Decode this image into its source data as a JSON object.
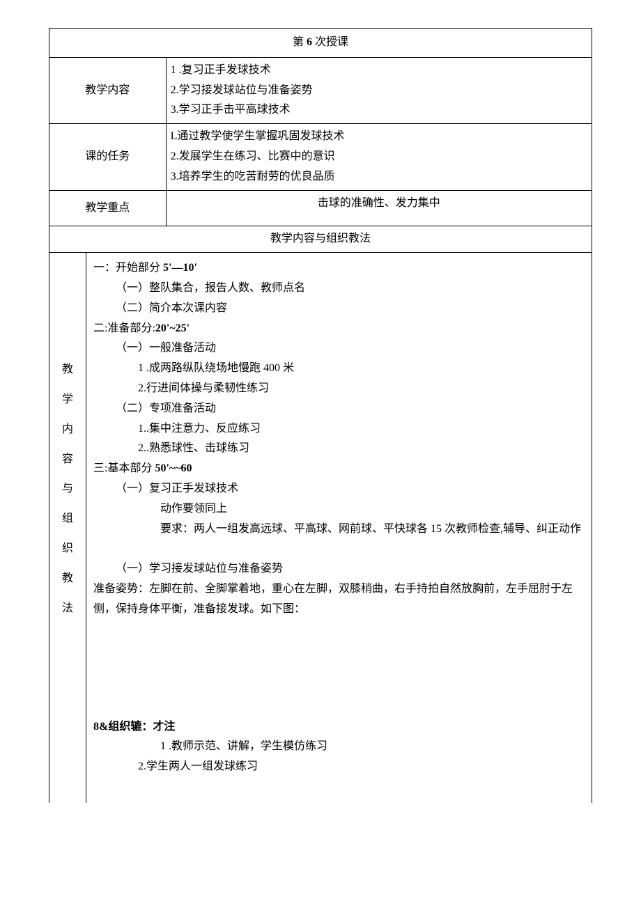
{
  "title_prefix": "第",
  "title_num": "6",
  "title_suffix": "次授课",
  "row1_label": "教学内容",
  "row1_lines": {
    "prefix1": "1",
    "l1": "         .复习正手发球技术",
    "l2": "2.学习接发球站位与准备姿势",
    "l3": "3.学习正手击平高球技术"
  },
  "row2_label": "课的任务",
  "row2_lines": {
    "l1": "L通过教学使学生掌握巩固发球技术",
    "l2": "2.发展学生在练习、比赛中的意识",
    "l3": "3.培养学生的吃苦耐劳的优良品质"
  },
  "row3_label": "教学重点",
  "row3_content": "击球的准确性、发力集中",
  "section_header": "教学内容与组织教法",
  "vertical_label": [
    "教",
    "学",
    "内",
    "容",
    "与",
    "组",
    "织",
    "教",
    "法"
  ],
  "body": {
    "s1_title_a": "一：开始部分 ",
    "s1_title_b": "5'—10'",
    "s1_1": "（一）整队集合，报告人数、教师点名",
    "s1_2": "（二）简介本次课内容",
    "s2_title_a": "二:准备部分:",
    "s2_title_b": "20'~25'",
    "s2_a": "（一）一般准备活动",
    "s2_a1_pre": "1",
    "s2_a1": "         .成两路纵队绕场地慢跑 400 米",
    "s2_a2": "2.行进间体操与柔韧性练习",
    "s2_b": "（二）专项准备活动",
    "s2_b1": "1..集中注意力、反应练习",
    "s2_b2": "2..熟悉球性、击球练习",
    "s3_title_a": "三:基本部分 ",
    "s3_title_b": "50'~~60",
    "s3_a": "（一）复习正手发球技术",
    "s3_a1": "动作要领同上",
    "s3_a2": "要求：两人一组发高远球、平高球、网前球、平快球各 15 次教师检查,辅导、纠正动作",
    "s3_b": "（一）学习接发球站位与准备姿势",
    "s3_b_desc": "准备姿势：左脚在前、全脚掌着地，重心在左脚，双膝稍曲，右手持拍自然放胸前，左手屈肘于左侧，保持身体平衡，准备接发球。如下图：",
    "s3_org_label": "8&组织辘：才注",
    "s3_org_1_pre": "1",
    "s3_org_1": "     .教师示范、讲解，学生模仿练习",
    "s3_org_2": "2.学生两人一组发球练习"
  }
}
